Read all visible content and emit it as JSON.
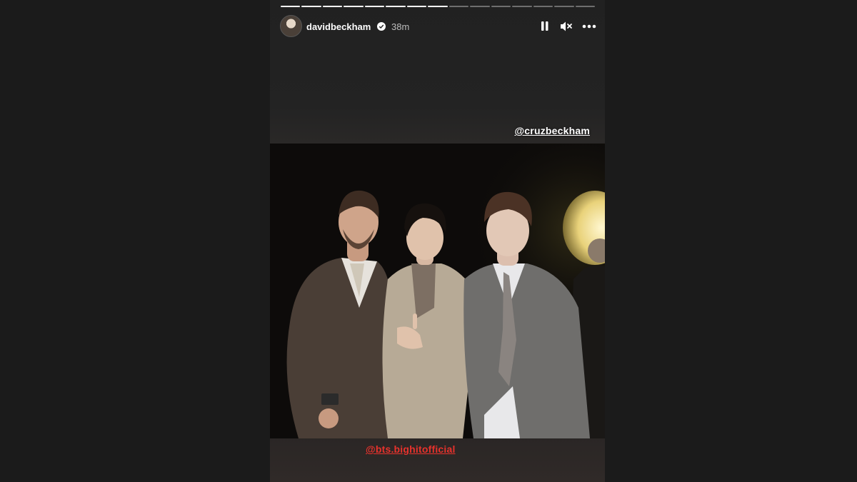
{
  "story": {
    "progress": {
      "total_segments": 15,
      "completed_segments": 8
    },
    "header": {
      "username": "davidbeckham",
      "verified": true,
      "time_ago": "38m",
      "icons": [
        "pause-icon",
        "mute-icon",
        "more-icon"
      ]
    },
    "mentions": {
      "top": "@cruzbeckham",
      "bottom": "@bts.bighitofficial"
    },
    "colors": {
      "background": "#1b1b1b",
      "mention_red": "#e8322c",
      "text": "#ffffff",
      "muted_text": "#bdbdbd"
    }
  }
}
